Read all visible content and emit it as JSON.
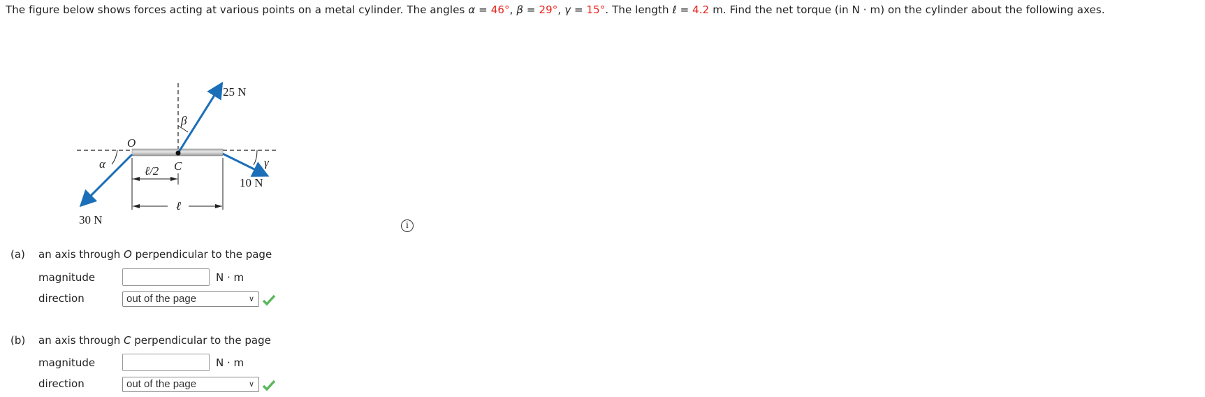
{
  "question": {
    "intro": "The figure below shows forces acting at various points on a metal cylinder. The angles ",
    "alpha_sym": "α",
    "alpha_val": "46°",
    "beta_sym": "β",
    "beta_val": "29°",
    "gamma_sym": "γ",
    "gamma_val": "15°",
    "length_text": ". The length ",
    "ell_sym": "ℓ",
    "ell_val": "4.2",
    "tail": " m. Find the net torque (in N · m) on the cylinder about the following axes."
  },
  "figure": {
    "force_25": "25 N",
    "force_30": "30 N",
    "force_10": "10 N",
    "point_o": "O",
    "point_c": "C",
    "half_length": "ℓ/2",
    "length": "ℓ",
    "alpha": "α",
    "beta": "β",
    "gamma": "γ",
    "arrow_color": "#1b6fb8"
  },
  "info_icon": "i",
  "parts": [
    {
      "label": "(a)",
      "text_pre": "an axis through ",
      "point": "O",
      "text_post": " perpendicular to the page",
      "magnitude_label": "magnitude",
      "magnitude_value": "",
      "unit": "N · m",
      "direction_label": "direction",
      "direction_value": "out of the page",
      "status": "correct"
    },
    {
      "label": "(b)",
      "text_pre": "an axis through ",
      "point": "C",
      "text_post": " perpendicular to the page",
      "magnitude_label": "magnitude",
      "magnitude_value": "",
      "unit": "N · m",
      "direction_label": "direction",
      "direction_value": "out of the page",
      "status": "correct"
    }
  ],
  "colors": {
    "given_value": "#e8231b",
    "check": "#5cb85c"
  }
}
